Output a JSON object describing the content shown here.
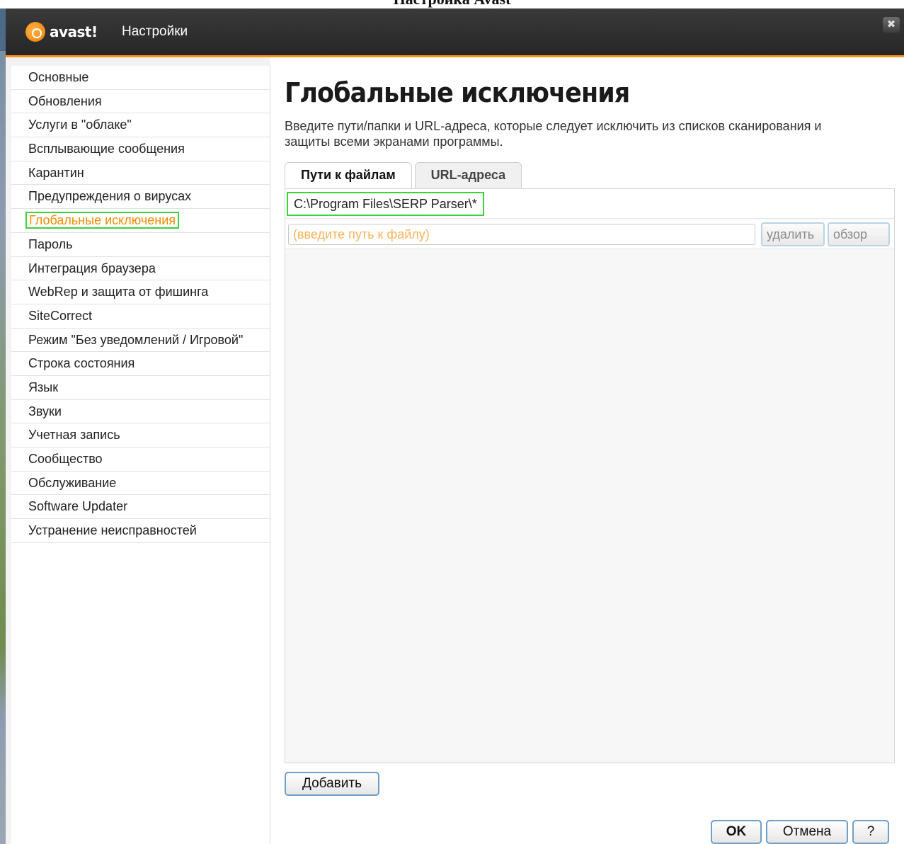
{
  "document": {
    "header": "Настройка Avast"
  },
  "window": {
    "logo_text": "avast!",
    "title": "Настройки",
    "close_symbol": "✖"
  },
  "sidebar": {
    "items": [
      {
        "label": "Основные"
      },
      {
        "label": "Обновления"
      },
      {
        "label": "Услуги в \"облаке\""
      },
      {
        "label": "Всплывающие сообщения"
      },
      {
        "label": "Карантин"
      },
      {
        "label": "Предупреждения о вирусах"
      },
      {
        "label": "Глобальные исключения",
        "active": true
      },
      {
        "label": "Пароль"
      },
      {
        "label": "Интеграция браузера"
      },
      {
        "label": "WebRep и защита от фишинга"
      },
      {
        "label": "SiteCorrect"
      },
      {
        "label": "Режим \"Без уведомлений / Игровой\""
      },
      {
        "label": "Строка состояния"
      },
      {
        "label": "Язык"
      },
      {
        "label": "Звуки"
      },
      {
        "label": "Учетная запись"
      },
      {
        "label": "Сообщество"
      },
      {
        "label": "Обслуживание"
      },
      {
        "label": "Software Updater"
      },
      {
        "label": "Устранение неисправностей"
      }
    ]
  },
  "main": {
    "title": "Глобальные исключения",
    "description": "Введите пути/папки и URL-адреса, которые следует исключить из списков сканирования и защиты всеми экранами программы.",
    "tabs": [
      {
        "label": "Пути к файлам",
        "active": true
      },
      {
        "label": "URL-адреса",
        "active": false
      }
    ],
    "entries": [
      "C:\\Program Files\\SERP Parser\\*"
    ],
    "path_input": {
      "value": "",
      "placeholder": "(введите путь к файлу)"
    },
    "delete_label": "удалить",
    "browse_label": "обзор",
    "add_label": "Добавить"
  },
  "footer": {
    "ok_label": "OK",
    "cancel_label": "Отмена",
    "help_label": "?"
  },
  "colors": {
    "accent_orange": "#f7941d",
    "highlight_green": "#3ad33a",
    "active_item": "#f28b00",
    "titlebar": "#262626"
  }
}
